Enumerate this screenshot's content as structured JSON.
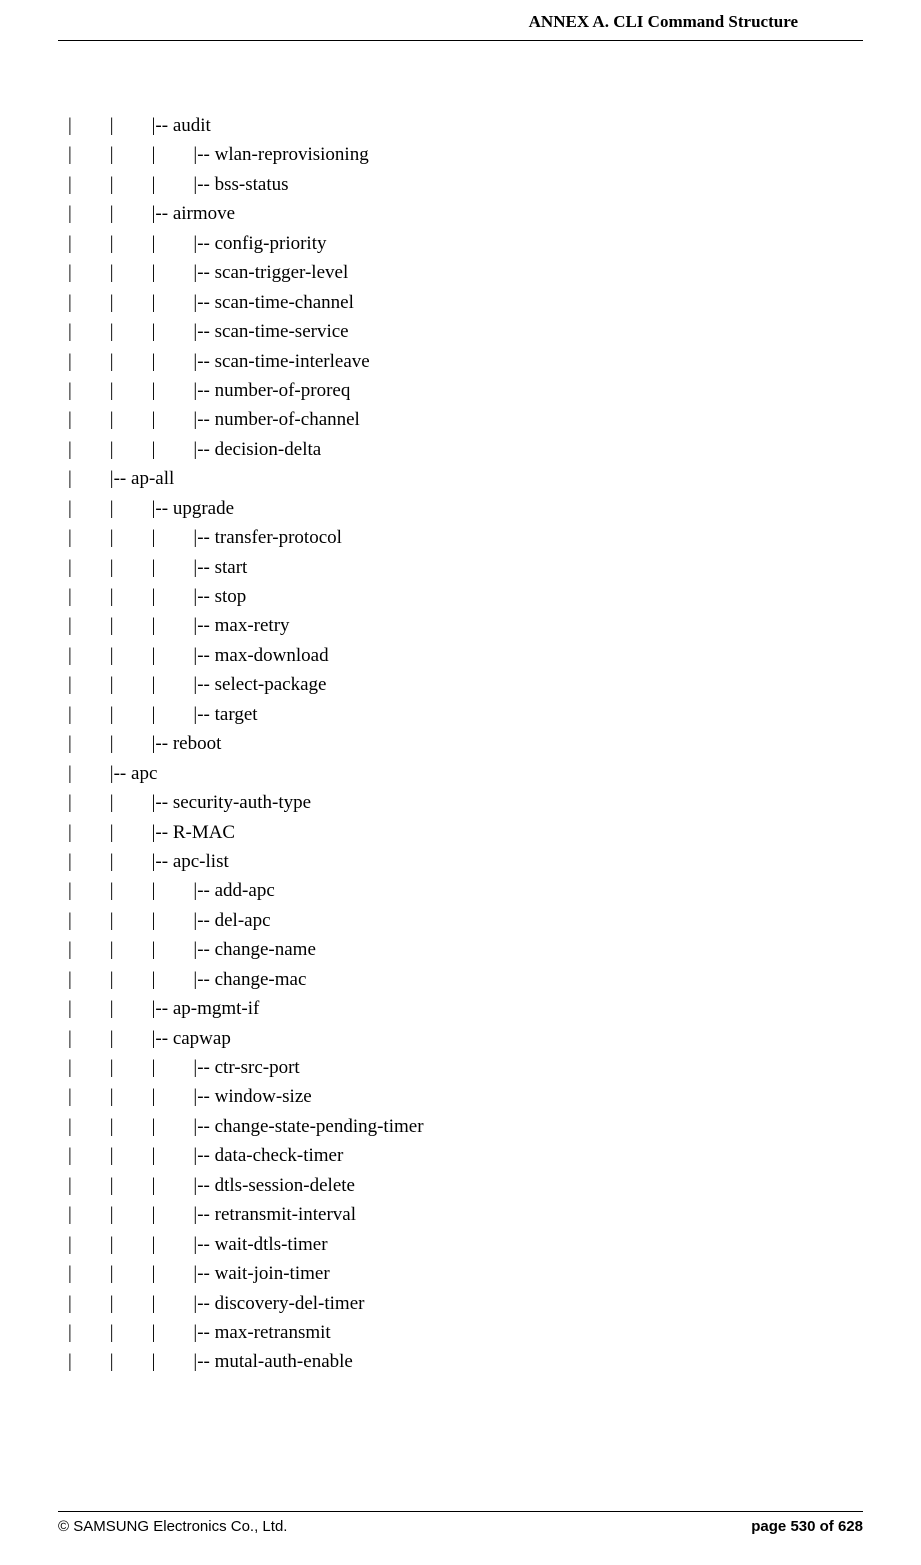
{
  "header": {
    "title": "ANNEX A. CLI Command Structure"
  },
  "lines": [
    "|        |        |-- audit",
    "|        |        |        |-- wlan-reprovisioning",
    "|        |        |        |-- bss-status",
    "|        |        |-- airmove",
    "|        |        |        |-- config-priority",
    "|        |        |        |-- scan-trigger-level",
    "|        |        |        |-- scan-time-channel",
    "|        |        |        |-- scan-time-service",
    "|        |        |        |-- scan-time-interleave",
    "|        |        |        |-- number-of-proreq",
    "|        |        |        |-- number-of-channel",
    "|        |        |        |-- decision-delta",
    "|        |-- ap-all",
    "|        |        |-- upgrade",
    "|        |        |        |-- transfer-protocol",
    "|        |        |        |-- start",
    "|        |        |        |-- stop",
    "|        |        |        |-- max-retry",
    "|        |        |        |-- max-download",
    "|        |        |        |-- select-package",
    "|        |        |        |-- target",
    "|        |        |-- reboot",
    "|        |-- apc",
    "|        |        |-- security-auth-type",
    "|        |        |-- R-MAC",
    "|        |        |-- apc-list",
    "|        |        |        |-- add-apc",
    "|        |        |        |-- del-apc",
    "|        |        |        |-- change-name",
    "|        |        |        |-- change-mac",
    "|        |        |-- ap-mgmt-if",
    "|        |        |-- capwap",
    "|        |        |        |-- ctr-src-port",
    "|        |        |        |-- window-size",
    "|        |        |        |-- change-state-pending-timer",
    "|        |        |        |-- data-check-timer",
    "|        |        |        |-- dtls-session-delete",
    "|        |        |        |-- retransmit-interval",
    "|        |        |        |-- wait-dtls-timer",
    "|        |        |        |-- wait-join-timer",
    "|        |        |        |-- discovery-del-timer",
    "|        |        |        |-- max-retransmit",
    "|        |        |        |-- mutal-auth-enable"
  ],
  "footer": {
    "copyright": "© SAMSUNG Electronics Co., Ltd.",
    "page": "page 530 of 628"
  }
}
